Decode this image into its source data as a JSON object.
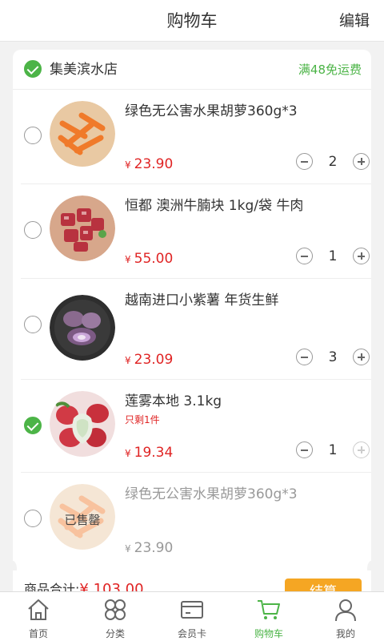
{
  "header": {
    "title": "购物车",
    "edit_label": "编辑"
  },
  "store": {
    "name": "集美滨水店",
    "shipping_note": "满48免运费",
    "checked": true
  },
  "items": [
    {
      "name": "绿色无公害水果胡萝360g*3",
      "price": "23.90",
      "qty": "2",
      "checked": false,
      "image_icon": "carrot-image"
    },
    {
      "name": "恒都 澳洲牛腩块 1kg/袋 牛肉",
      "price": "55.00",
      "qty": "1",
      "checked": false,
      "image_icon": "beef-image"
    },
    {
      "name": "越南进口小紫薯 年货生鲜",
      "price": "23.09",
      "qty": "3",
      "checked": false,
      "image_icon": "purple-potato-image"
    },
    {
      "name": "莲雾本地 3.1kg",
      "stock_note": "只剩1件",
      "price": "19.34",
      "qty": "1",
      "checked": true,
      "image_icon": "wax-apple-image"
    },
    {
      "name": "绿色无公害水果胡萝360g*3",
      "price": "23.90",
      "sold_out_label": "已售罄",
      "checked": false,
      "image_icon": "carrot-image"
    }
  ],
  "currency": "¥",
  "summary": {
    "total_label": "商品合计:",
    "total_value": "¥ 103.00",
    "checkout_label": "结算"
  },
  "tabbar": [
    {
      "label": "首页",
      "icon": "home-icon"
    },
    {
      "label": "分类",
      "icon": "category-icon"
    },
    {
      "label": "会员卡",
      "icon": "member-card-icon"
    },
    {
      "label": "购物车",
      "icon": "cart-icon",
      "active": true
    },
    {
      "label": "我的",
      "icon": "user-icon"
    }
  ],
  "colors": {
    "accent": "#4cb447",
    "price": "#e02424",
    "checkout": "#f5a623"
  }
}
